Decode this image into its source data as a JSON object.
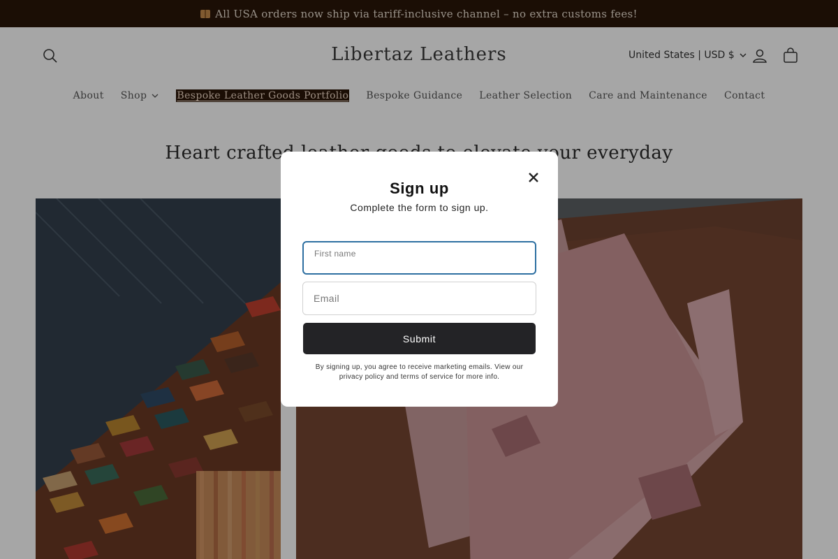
{
  "announcement": {
    "text": "All USA orders now ship via tariff-inclusive channel – no extra customs fees!",
    "icon": "package-icon"
  },
  "header": {
    "brand": "Libertaz Leathers",
    "country": "United States | USD $",
    "icons": [
      "search-icon",
      "account-icon",
      "cart-icon"
    ]
  },
  "nav": {
    "items": [
      {
        "label": "About"
      },
      {
        "label": "Shop"
      },
      {
        "label": "Bespoke Leather Goods Portfolio"
      },
      {
        "label": "Bespoke Guidance"
      },
      {
        "label": "Leather Selection"
      },
      {
        "label": "Care and Maintenance"
      },
      {
        "label": "Contact"
      }
    ],
    "active_index": 2
  },
  "main": {
    "heading": "Heart crafted leather goods to elevate your everyday"
  },
  "modal": {
    "title": "Sign up",
    "subtitle": "Complete the form to sign up.",
    "first_name_label": "First name",
    "first_name_value": "",
    "email_placeholder": "Email",
    "email_value": "",
    "submit_label": "Submit",
    "disclaimer": "By signing up, you agree to receive marketing emails. View our privacy policy and terms of service for more info."
  },
  "colors": {
    "announcement_bg": "#2a1609",
    "submit_bg": "#232326",
    "focus_border": "#2d6fa1"
  }
}
